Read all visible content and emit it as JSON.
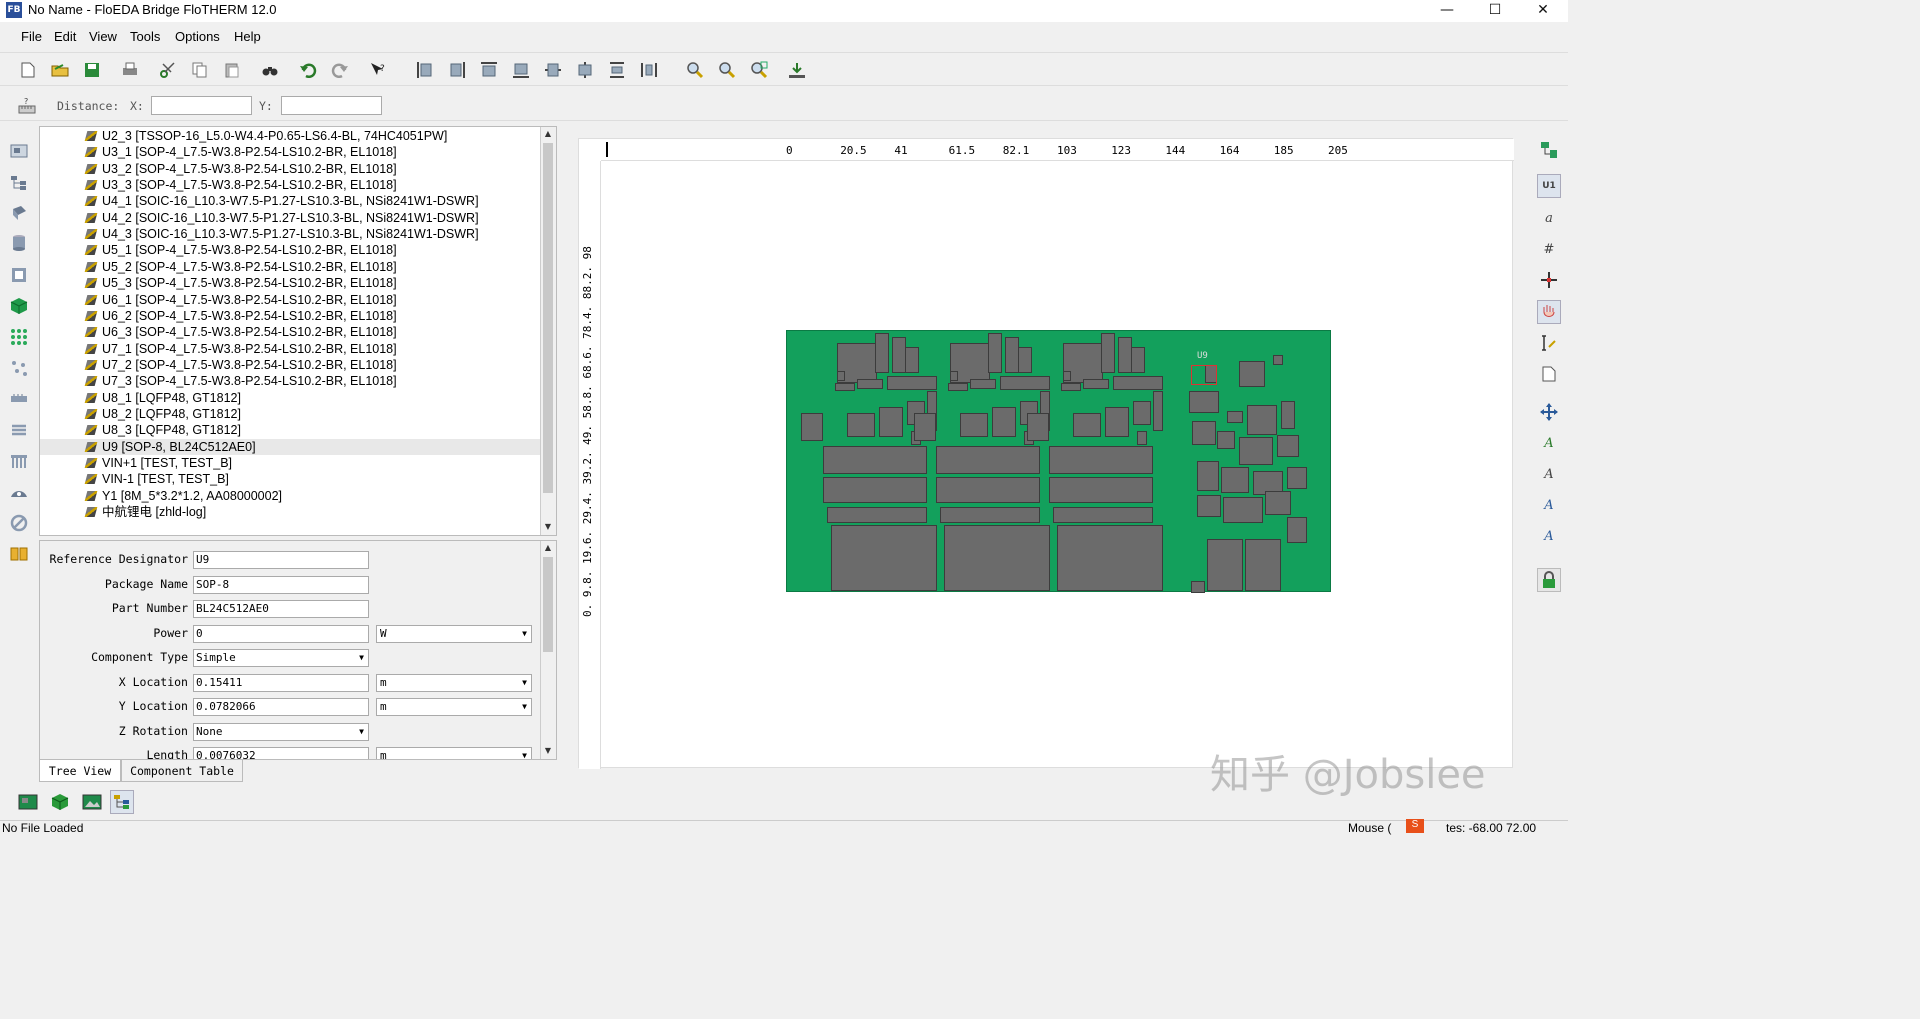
{
  "window": {
    "title": "No Name - FloEDA Bridge FloTHERM 12.0",
    "app_icon_text": "FB",
    "minimize": "—",
    "maximize": "☐",
    "close": "✕"
  },
  "menu": [
    "File",
    "Edit",
    "View",
    "Tools",
    "Options",
    "Help"
  ],
  "toolbar": {
    "icons": [
      "new-file-icon",
      "open-folder-icon",
      "save-icon",
      "print-icon",
      "cut-icon",
      "copy-icon",
      "paste-icon",
      "find-icon",
      "undo-icon",
      "redo-icon",
      "whats-this-icon",
      "align-left-icon",
      "align-right-icon",
      "align-top-icon",
      "align-bottom-icon",
      "center-horizontal-icon",
      "center-vertical-icon",
      "space-vertical-icon",
      "space-horizontal-icon",
      "zoom-in-icon",
      "zoom-out-icon",
      "zoom-fit-icon",
      "export-icon"
    ]
  },
  "distance_bar": {
    "label": "Distance:",
    "x_label": "X:",
    "x_value": "",
    "y_label": "Y:",
    "y_value": ""
  },
  "tree": {
    "items": [
      {
        "label": "U2_3 [TSSOP-16_L5.0-W4.4-P0.65-LS6.4-BL, 74HC4051PW]"
      },
      {
        "label": "U3_1 [SOP-4_L7.5-W3.8-P2.54-LS10.2-BR, EL1018]"
      },
      {
        "label": "U3_2 [SOP-4_L7.5-W3.8-P2.54-LS10.2-BR, EL1018]"
      },
      {
        "label": "U3_3 [SOP-4_L7.5-W3.8-P2.54-LS10.2-BR, EL1018]"
      },
      {
        "label": "U4_1 [SOIC-16_L10.3-W7.5-P1.27-LS10.3-BL, NSi8241W1-DSWR]"
      },
      {
        "label": "U4_2 [SOIC-16_L10.3-W7.5-P1.27-LS10.3-BL, NSi8241W1-DSWR]"
      },
      {
        "label": "U4_3 [SOIC-16_L10.3-W7.5-P1.27-LS10.3-BL, NSi8241W1-DSWR]"
      },
      {
        "label": "U5_1 [SOP-4_L7.5-W3.8-P2.54-LS10.2-BR, EL1018]"
      },
      {
        "label": "U5_2 [SOP-4_L7.5-W3.8-P2.54-LS10.2-BR, EL1018]"
      },
      {
        "label": "U5_3 [SOP-4_L7.5-W3.8-P2.54-LS10.2-BR, EL1018]"
      },
      {
        "label": "U6_1 [SOP-4_L7.5-W3.8-P2.54-LS10.2-BR, EL1018]"
      },
      {
        "label": "U6_2 [SOP-4_L7.5-W3.8-P2.54-LS10.2-BR, EL1018]"
      },
      {
        "label": "U6_3 [SOP-4_L7.5-W3.8-P2.54-LS10.2-BR, EL1018]"
      },
      {
        "label": "U7_1 [SOP-4_L7.5-W3.8-P2.54-LS10.2-BR, EL1018]"
      },
      {
        "label": "U7_2 [SOP-4_L7.5-W3.8-P2.54-LS10.2-BR, EL1018]"
      },
      {
        "label": "U7_3 [SOP-4_L7.5-W3.8-P2.54-LS10.2-BR, EL1018]"
      },
      {
        "label": "U8_1 [LQFP48, GT1812]"
      },
      {
        "label": "U8_2 [LQFP48, GT1812]"
      },
      {
        "label": "U8_3 [LQFP48, GT1812]"
      },
      {
        "label": "U9 [SOP-8, BL24C512AE0]",
        "selected": true
      },
      {
        "label": "VIN+1 [TEST, TEST_B]"
      },
      {
        "label": "VIN-1 [TEST, TEST_B]"
      },
      {
        "label": "Y1 [8M_5*3.2*1.2, AA08000002]"
      },
      {
        "label": "中航锂电 [zhld-log]"
      }
    ]
  },
  "properties": [
    {
      "label": "Reference Designator",
      "value": "U9"
    },
    {
      "label": "Package Name",
      "value": "SOP-8"
    },
    {
      "label": "Part Number",
      "value": "BL24C512AE0"
    },
    {
      "label": "Power",
      "value": "0",
      "unit": "W"
    },
    {
      "label": "Component Type",
      "value": "Simple",
      "dropdown": true
    },
    {
      "label": "X Location",
      "value": "0.15411",
      "unit": "m"
    },
    {
      "label": "Y Location",
      "value": "0.0782066",
      "unit": "m"
    },
    {
      "label": "Z Rotation",
      "value": "None",
      "dropdown": true
    },
    {
      "label": "Length",
      "value": "0.0076032",
      "unit": "m"
    }
  ],
  "tabs": [
    "Tree View",
    "Component Table"
  ],
  "ruler": {
    "h_ticks": [
      "0",
      "20.5",
      "41",
      "61.5",
      "82.1",
      "103",
      "123",
      "144",
      "164",
      "185",
      "205"
    ],
    "v_ticks": [
      "0",
      "9.8",
      "19.6",
      "29.4",
      "39.2",
      "49",
      "58.8",
      "68.6",
      "78.4",
      "88.2",
      "98"
    ]
  },
  "board": {
    "selected_label": "U9",
    "board_color": "#13a05c",
    "component_color": "#6b6b6b"
  },
  "right_toolbar": {
    "icons": [
      "view-board-icon",
      "reference-designator-icon",
      "text-a-icon",
      "hash-icon",
      "move-icon",
      "hand-icon",
      "measure-icon",
      "page-icon",
      "rotate-icon",
      "font-add-icon",
      "font-icon",
      "font-rotate-icon",
      "font-flip-icon",
      "lock-icon"
    ]
  },
  "bottom_toolbar": {
    "icons": [
      "board-view-icon",
      "3d-cube-icon",
      "image-view-icon",
      "tree-view-icon"
    ]
  },
  "status": {
    "left": "No File Loaded",
    "right_mouse": "Mouse (",
    "right_coords": "tes: -68.00 72.00"
  },
  "watermark": "知乎 @Jobslee"
}
